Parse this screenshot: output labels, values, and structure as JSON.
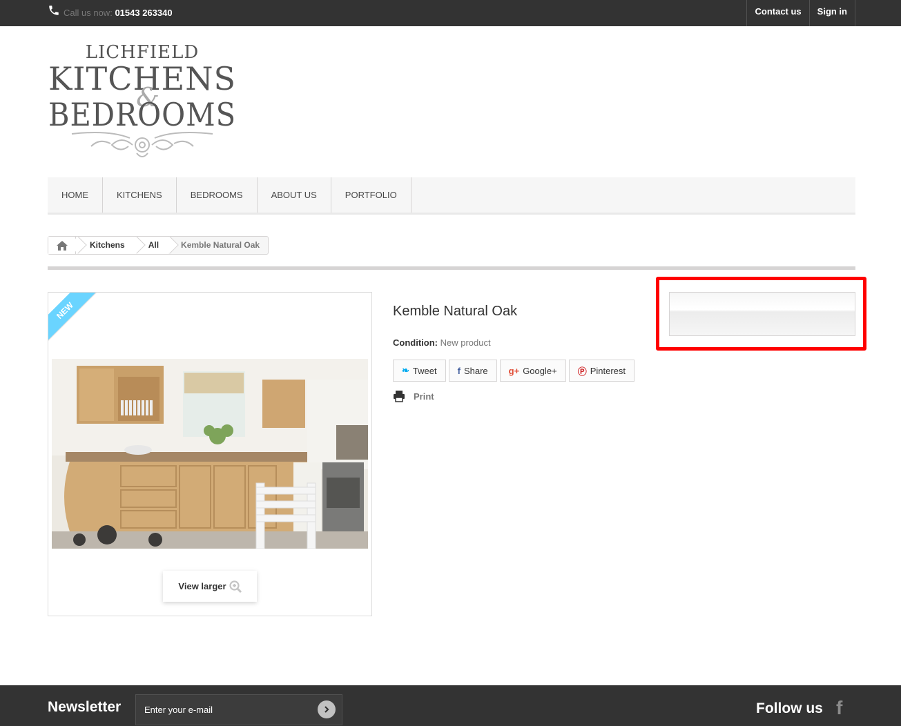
{
  "topbar": {
    "call_label": "Call us now:",
    "phone": "01543 263340",
    "contact_label": "Contact us",
    "signin_label": "Sign in"
  },
  "logo": {
    "line1": "LICHFIELD",
    "line2": "KITCHENS",
    "line3": "BEDROOMS",
    "ampersand": "&"
  },
  "nav": {
    "items": [
      "HOME",
      "KITCHENS",
      "BEDROOMS",
      "ABOUT US",
      "PORTFOLIO"
    ]
  },
  "breadcrumb": {
    "items": [
      "Kitchens",
      "All"
    ],
    "current": "Kemble Natural Oak"
  },
  "product": {
    "badge": "New",
    "title": "Kemble Natural Oak",
    "condition_label": "Condition:",
    "condition_value": "New product",
    "view_larger": "View larger",
    "print_label": "Print",
    "social": [
      "Tweet",
      "Share",
      "Google+",
      "Pinterest"
    ]
  },
  "footer": {
    "newsletter_title": "Newsletter",
    "newsletter_placeholder": "Enter your e-mail",
    "follow_title": "Follow us"
  },
  "colors": {
    "topbar_bg": "#333333",
    "ribbon": "#6ad4ff",
    "highlight": "#ff0000"
  }
}
